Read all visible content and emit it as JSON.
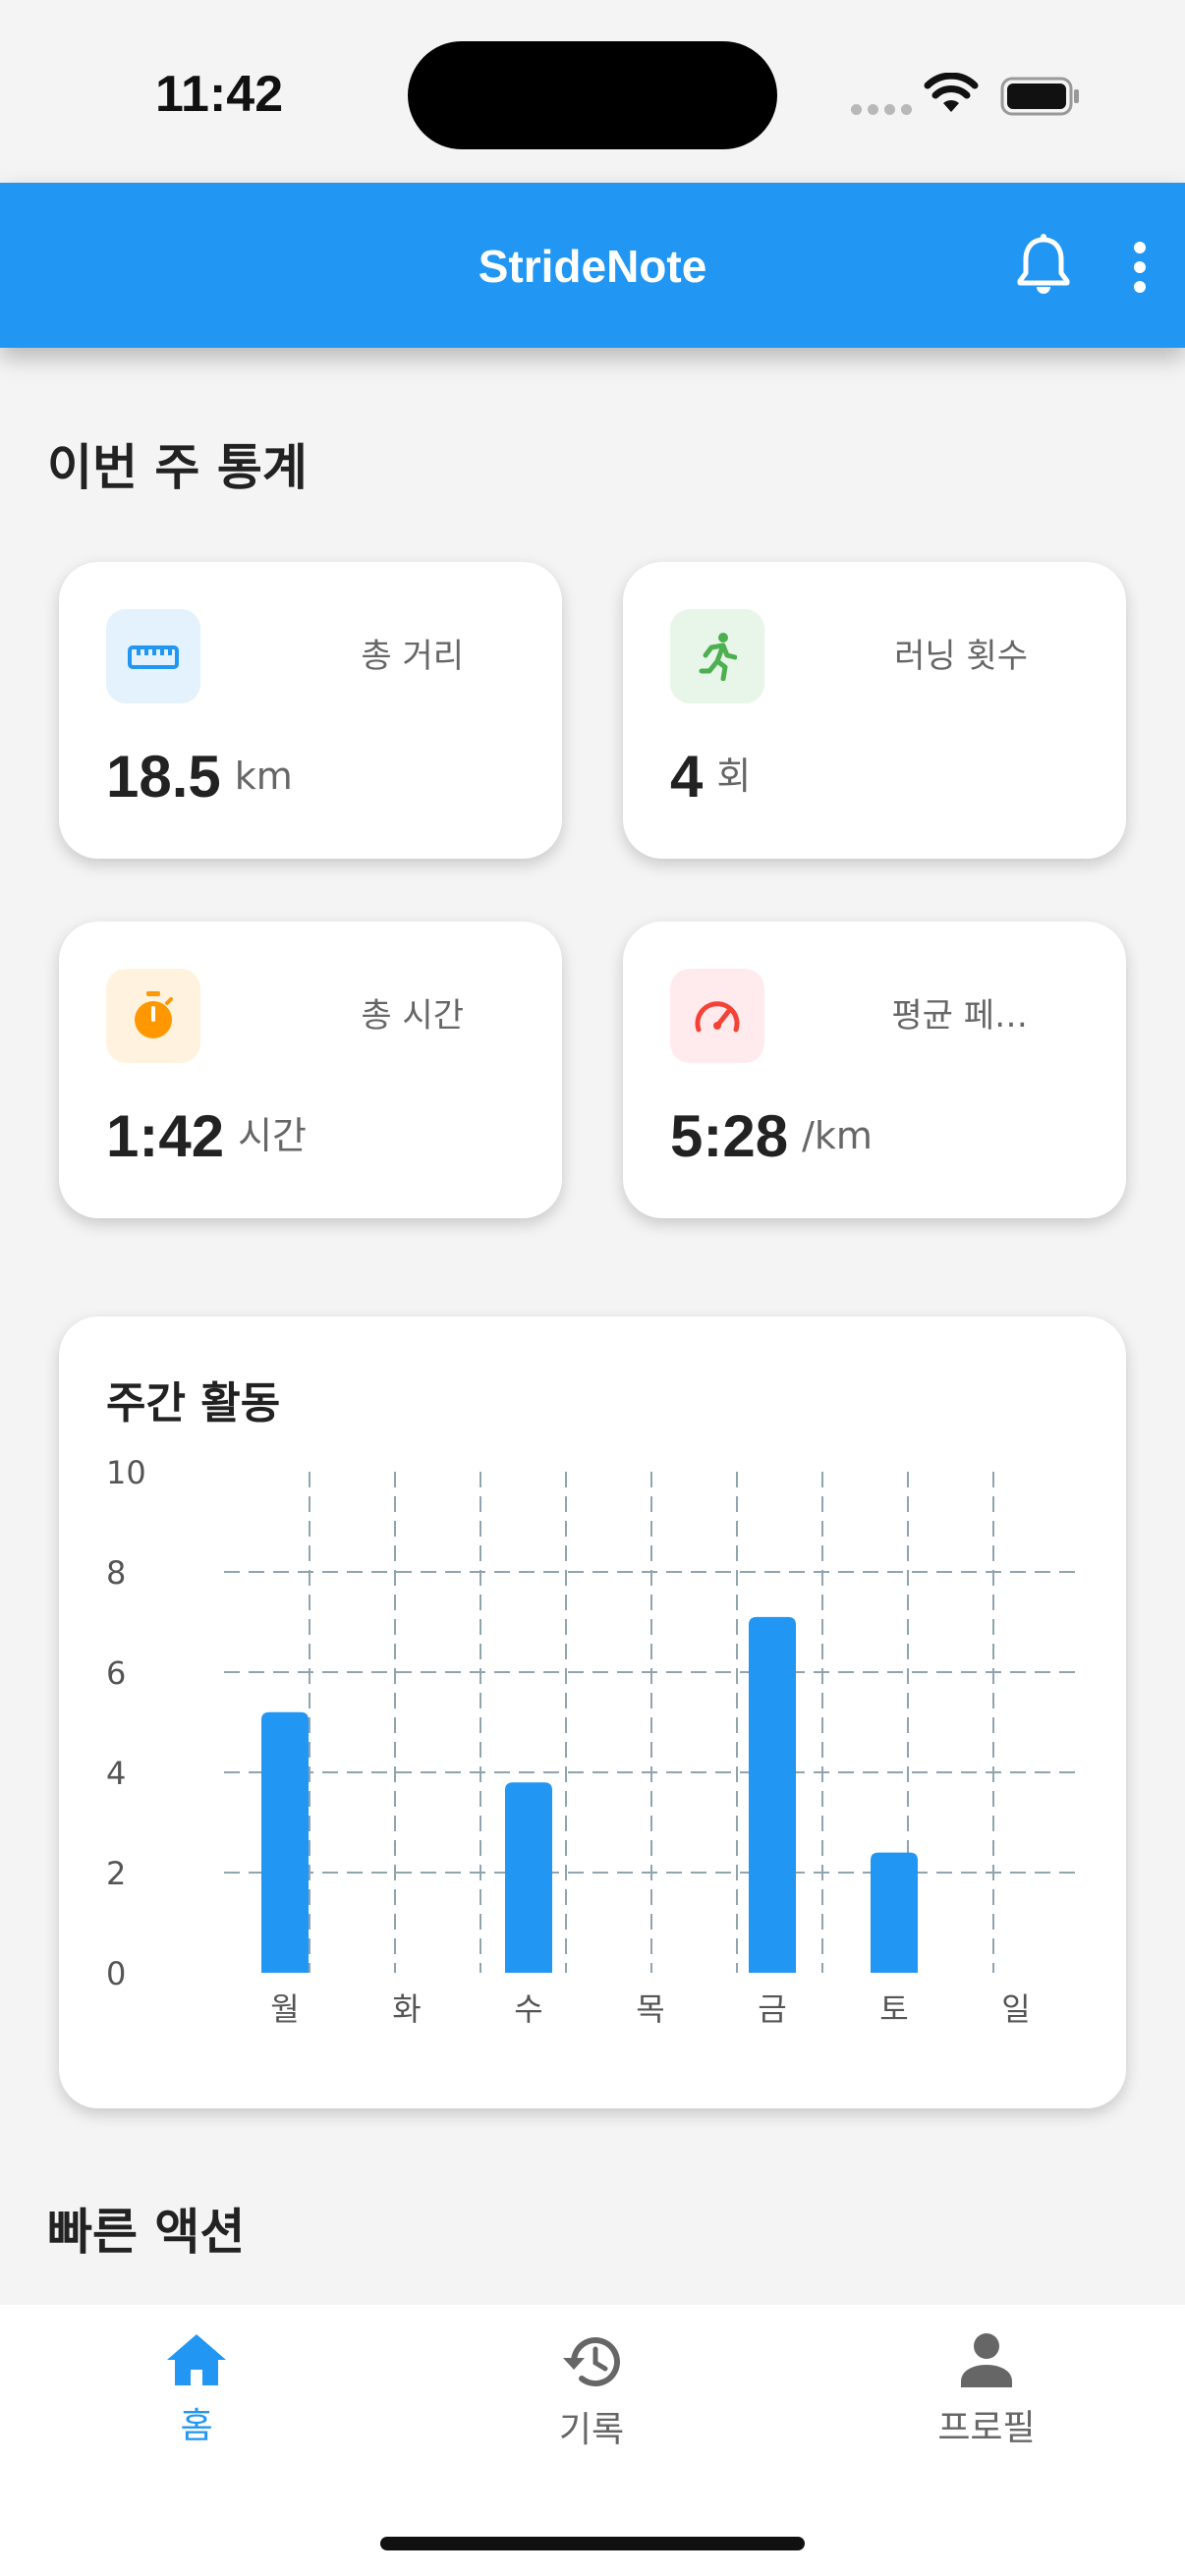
{
  "status_bar": {
    "time": "11:42"
  },
  "app_bar": {
    "title": "StrideNote"
  },
  "weekly_stats": {
    "title": "이번 주 통계",
    "cards": [
      {
        "label": "총 거리",
        "value": "18.5",
        "unit": "km",
        "icon": "ruler-icon",
        "accent": "#2196f3",
        "icon_bg": "#e3f2fd"
      },
      {
        "label": "러닝 횟수",
        "value": "4",
        "unit": "회",
        "icon": "running-icon",
        "accent": "#4caf50",
        "icon_bg": "#e8f5e9"
      },
      {
        "label": "총 시간",
        "value": "1:42",
        "unit": "시간",
        "icon": "stopwatch-icon",
        "accent": "#ff9800",
        "icon_bg": "#fff3e0"
      },
      {
        "label": "평균 페…",
        "value": "5:28",
        "unit": "/km",
        "icon": "speedometer-icon",
        "accent": "#f44336",
        "icon_bg": "#ffebee"
      }
    ]
  },
  "chart_data": {
    "type": "bar",
    "title": "주간 활동",
    "categories": [
      "월",
      "화",
      "수",
      "목",
      "금",
      "토",
      "일"
    ],
    "values": [
      5.2,
      0,
      3.8,
      0,
      7.1,
      2.4,
      0
    ],
    "ylim": [
      0,
      10
    ],
    "yticks": [
      "0",
      "2",
      "4",
      "6",
      "8",
      "10"
    ],
    "grid": true,
    "bar_color": "#2196f3"
  },
  "quick_actions": {
    "title": "빠른 액션"
  },
  "bottom_nav": {
    "items": [
      {
        "label": "홈",
        "icon": "home-icon",
        "active": true
      },
      {
        "label": "기록",
        "icon": "history-icon",
        "active": false
      },
      {
        "label": "프로필",
        "icon": "profile-icon",
        "active": false
      }
    ],
    "active_color": "#2196f3",
    "inactive_color": "#666666"
  }
}
